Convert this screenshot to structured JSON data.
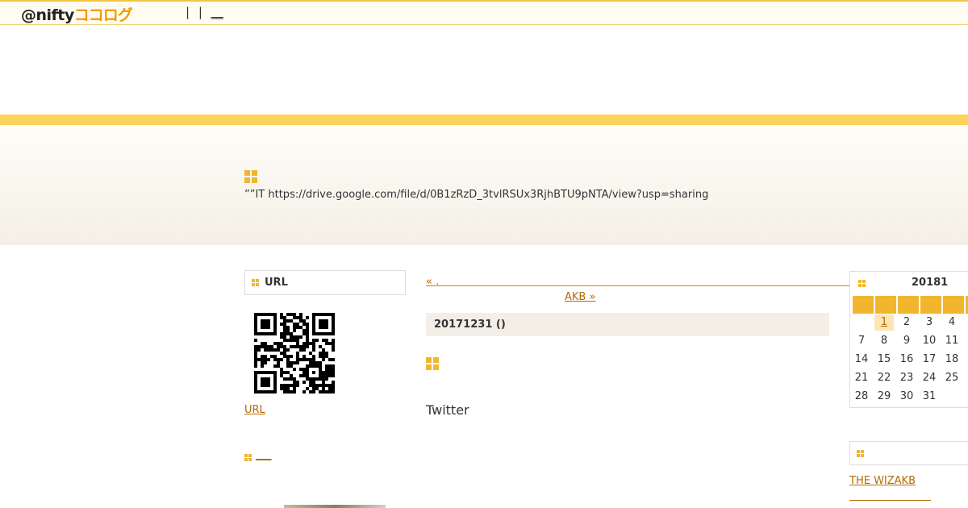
{
  "header": {
    "logo_at_nifty": "@nifty",
    "logo_cocolog": "ココログ",
    "links": [
      "|",
      "|",
      "__"
    ]
  },
  "banner": {
    "text": "””IT  https://drive.google.com/file/d/0B1zRzD_3tvlRSUx3RjhBTU9pNTA/view?usp=sharing"
  },
  "sidebar_left": {
    "url_box_title": "URL",
    "url_link": "URL",
    "second_link": "___"
  },
  "main": {
    "prev_link": "«      .",
    "next_link": "AKB »",
    "date": "20171231 ()",
    "body": "Twitter"
  },
  "calendar": {
    "title": "20181",
    "weeks": [
      [
        "",
        "1",
        "2",
        "3",
        "4"
      ],
      [
        "7",
        "8",
        "9",
        "10",
        "11"
      ],
      [
        "14",
        "15",
        "16",
        "17",
        "18"
      ],
      [
        "21",
        "22",
        "23",
        "24",
        "25"
      ],
      [
        "28",
        "29",
        "30",
        "31",
        ""
      ]
    ],
    "today": "1"
  },
  "sidebar_right": {
    "link": "THE WIZAKB"
  },
  "colors": {
    "accent_yellow": "#f2b52e",
    "stripe_yellow": "#fdd35b",
    "link": "#b36b00"
  }
}
